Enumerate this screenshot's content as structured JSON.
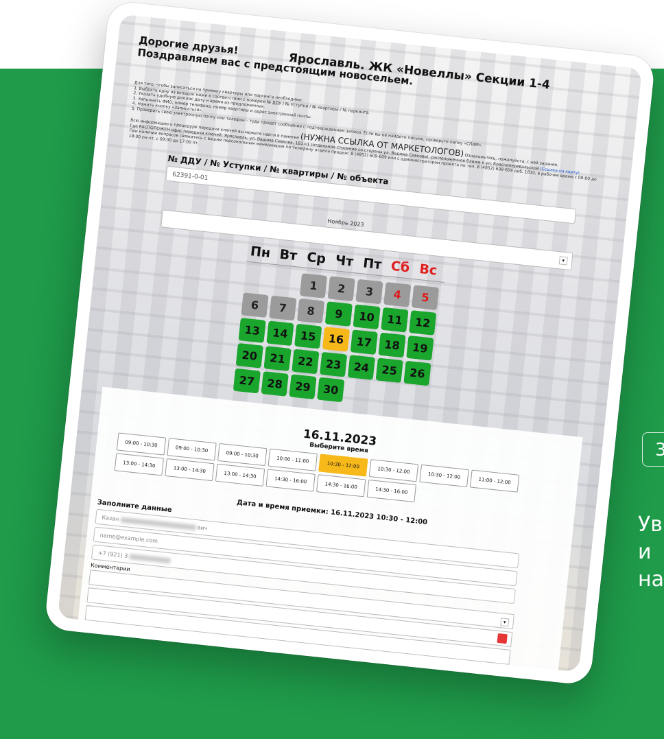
{
  "greeting_line1": "Дорогие друзья!",
  "greeting_line2": "Поздравляем вас с предстоящим новосельем.",
  "title": "Ярославль. ЖК «Новеллы» Секции 1-4",
  "instructions": [
    "Для того, чтобы записаться на приемку квартиры или паркинга необходимо:",
    "1. Выбрать одну из вкладок ниже в соответствии с номером № ДДУ / № Уступки / № квартиры / № паркинга.",
    "2. Указать удобную для вас дату и время из предложенных.",
    "3. Заполнить ФИО, номер телефона, номер квартиры и адрес электронной почты.",
    "4. Нажать кнопку «Записаться».",
    "5. Проверить свою электронную почту или телефон – туда придет сообщение с подтверждением записи. Если вы не найдете письмо, проверьте папку «СПАМ»."
  ],
  "info_text_1": "Всю информацию о процедуре передачи ключей вы можете найти в памятке",
  "info_link_big": "(НУЖНА ССЫЛКА ОТ МАРКЕТОЛОГОВ)",
  "info_text_2": "Ознакомьтесь, пожалуйста, с ней заранее.",
  "info_text_3": "Где РАСПОЛОЖЕН офис передачи ключей: Ярославль, ул. Вадима Сивкова, 181 к1 (отдельное строение со стороны ул. Вадима Сивкова), расположенное ближе к ул. Красноперевальской",
  "info_link_map": "(Ссылка на карту)",
  "info_text_4": "При наличии вопросов свяжитесь с вашим персональным менеджером по телефону отдела продаж: 8 (4852) 609-609 или с администратором проекта по тел. 8 (4852) 609-609 доб. 1810, в рабочее время с 09:00 до 18:00 пн-чт, с 09:00 до 17:00 пт.",
  "ddu_label": "№ ДДУ / № Уступки / № квартиры / № объекта",
  "ddu_value": "62391-0-01",
  "month_select": "Ноябрь 2023",
  "select_arrow": "▾",
  "weekdays": [
    "Пн",
    "Вт",
    "Ср",
    "Чт",
    "Пт",
    "Сб",
    "Вс"
  ],
  "calendar_days": [
    {
      "label": "",
      "state": "empty"
    },
    {
      "label": "",
      "state": "empty"
    },
    {
      "label": "1",
      "state": "closed"
    },
    {
      "label": "2",
      "state": "closed"
    },
    {
      "label": "3",
      "state": "closed"
    },
    {
      "label": "4",
      "state": "closed-weekend"
    },
    {
      "label": "5",
      "state": "closed-weekend"
    },
    {
      "label": "6",
      "state": "closed"
    },
    {
      "label": "7",
      "state": "closed"
    },
    {
      "label": "8",
      "state": "closed"
    },
    {
      "label": "9",
      "state": "available"
    },
    {
      "label": "10",
      "state": "available"
    },
    {
      "label": "11",
      "state": "available"
    },
    {
      "label": "12",
      "state": "available"
    },
    {
      "label": "13",
      "state": "available"
    },
    {
      "label": "14",
      "state": "available"
    },
    {
      "label": "15",
      "state": "available"
    },
    {
      "label": "16",
      "state": "selected"
    },
    {
      "label": "17",
      "state": "available"
    },
    {
      "label": "18",
      "state": "available"
    },
    {
      "label": "19",
      "state": "available"
    },
    {
      "label": "20",
      "state": "available"
    },
    {
      "label": "21",
      "state": "available"
    },
    {
      "label": "22",
      "state": "available"
    },
    {
      "label": "23",
      "state": "available"
    },
    {
      "label": "24",
      "state": "available"
    },
    {
      "label": "25",
      "state": "available"
    },
    {
      "label": "26",
      "state": "available"
    },
    {
      "label": "27",
      "state": "available"
    },
    {
      "label": "28",
      "state": "available"
    },
    {
      "label": "29",
      "state": "available"
    },
    {
      "label": "30",
      "state": "available"
    }
  ],
  "selected_date": "16.11.2023",
  "choose_time": "Выберите время",
  "time_slots": [
    {
      "label": "09:00 - 10:30",
      "active": false
    },
    {
      "label": "09:00 - 10:30",
      "active": false
    },
    {
      "label": "09:00 - 10:30",
      "active": false
    },
    {
      "label": "10:00 - 11:00",
      "active": false
    },
    {
      "label": "10:30 - 12:00",
      "active": true
    },
    {
      "label": "10:30 - 12:00",
      "active": false
    },
    {
      "label": "10:30 - 12:00",
      "active": false
    },
    {
      "label": "11:00 - 12:00",
      "active": false
    },
    {
      "label": "13:00 - 14:30",
      "active": false
    },
    {
      "label": "13:00 - 14:30",
      "active": false
    },
    {
      "label": "13:00 - 14:30",
      "active": false
    },
    {
      "label": "14:30 - 16:00",
      "active": false
    },
    {
      "label": "14:30 - 16:00",
      "active": false
    },
    {
      "label": "14:30 - 16:00",
      "active": false
    }
  ],
  "appointment_text": "Дата и время приемки: 16.11.2023 10:30 - 12:00",
  "fill_data": "Заполните данные",
  "name_prefix": "Казан",
  "name_suffix": "вич",
  "email_placeholder": "name@example.com",
  "phone_value": "+7 (921) 3",
  "comment_label": "Комментарии",
  "side_box_char": "3",
  "side_text": "Ув\nи \nна",
  "colors": {
    "green_bg": "#1f9b4a",
    "available": "#1aa52d",
    "selected": "#f7b81a",
    "closed": "#9b9b9b",
    "weekend_red": "#e01818"
  }
}
